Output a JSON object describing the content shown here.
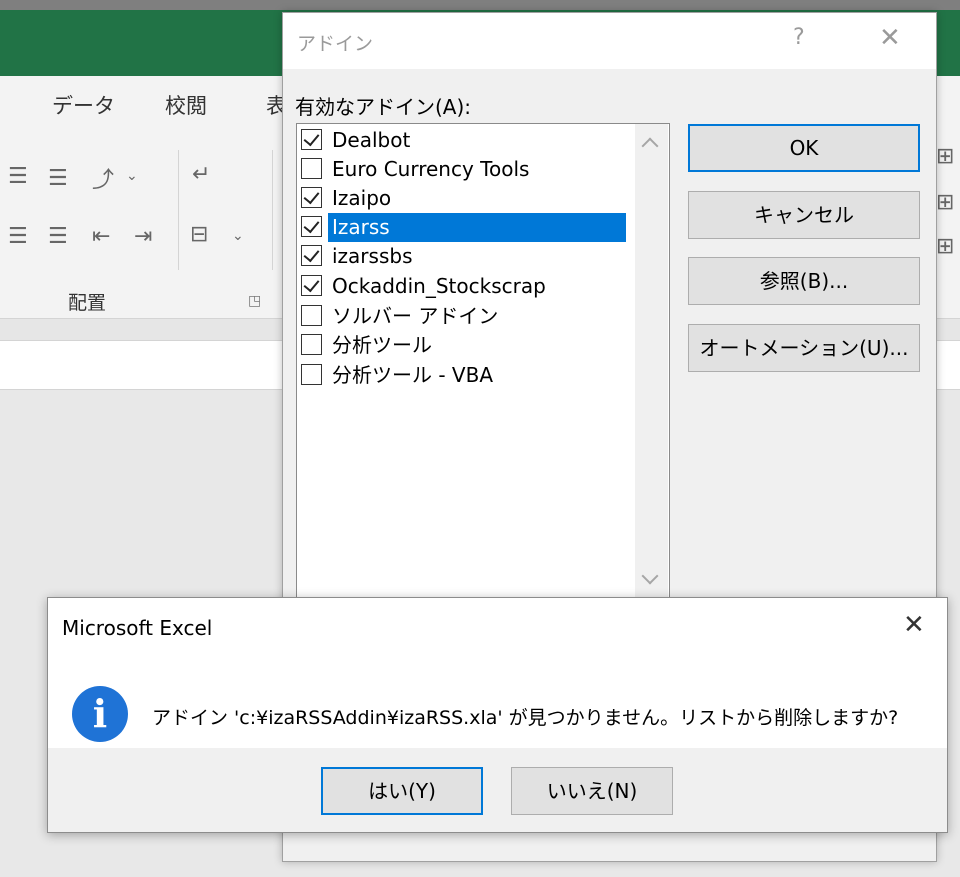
{
  "excel": {
    "ribbon_tabs": [
      "データ",
      "校閲",
      "表"
    ],
    "group_label": "配置",
    "icons": [
      "align-left-icon",
      "align-center-icon",
      "text-orientation-icon",
      "wrap-text-icon",
      "merge-center-icon",
      "indent-decrease-icon",
      "indent-increase-icon",
      "dialog-launcher-icon"
    ]
  },
  "addin_dialog": {
    "title": "アドイン",
    "help": "?",
    "close": "✕",
    "available_label": "有効なアドイン(A):",
    "items": [
      {
        "label": "Dealbot",
        "checked": true,
        "selected": false
      },
      {
        "label": "Euro Currency Tools",
        "checked": false,
        "selected": false
      },
      {
        "label": "Izaipo",
        "checked": true,
        "selected": false
      },
      {
        "label": "Izarss",
        "checked": true,
        "selected": true
      },
      {
        "label": "izarssbs",
        "checked": true,
        "selected": false
      },
      {
        "label": "Ockaddin_Stockscrap",
        "checked": true,
        "selected": false
      },
      {
        "label": "ソルバー アドイン",
        "checked": false,
        "selected": false
      },
      {
        "label": "分析ツール",
        "checked": false,
        "selected": false
      },
      {
        "label": "分析ツール - VBA",
        "checked": false,
        "selected": false
      }
    ],
    "buttons": {
      "ok": "OK",
      "cancel": "キャンセル",
      "browse": "参照(B)...",
      "automation": "オートメーション(U)..."
    }
  },
  "message_box": {
    "title": "Microsoft Excel",
    "close": "✕",
    "icon": "info-icon",
    "message": "アドイン 'c:¥izaRSSAddin¥izaRSS.xla' が見つかりません。リストから削除しますか?",
    "yes": "はい(Y)",
    "no": "いいえ(N)",
    "accent": "#0078d7"
  }
}
